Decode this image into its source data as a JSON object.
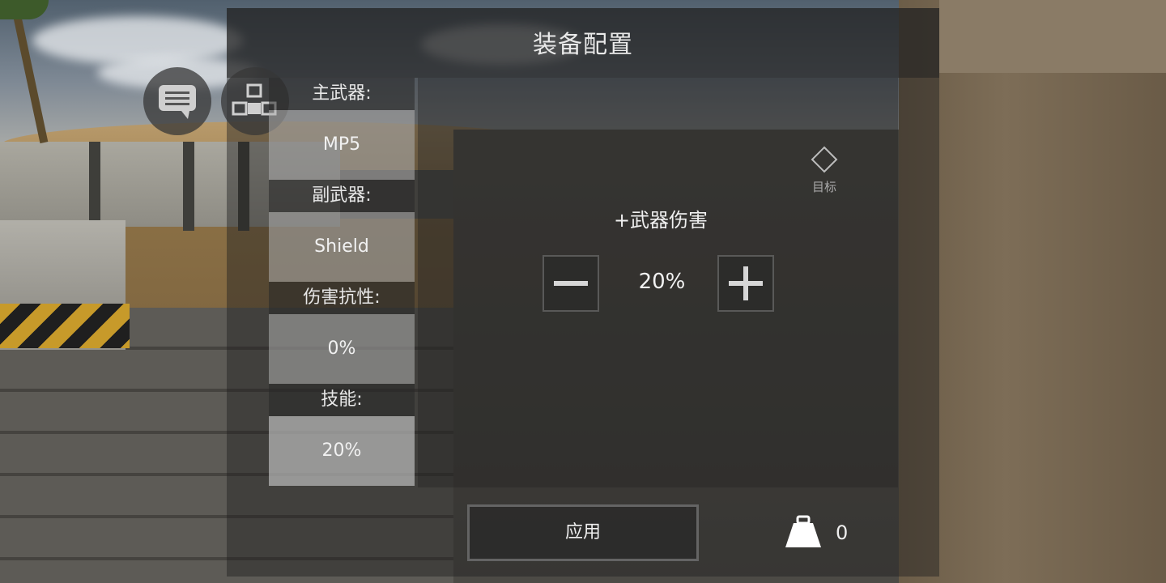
{
  "screen": {
    "title": "装备配置"
  },
  "hud": {
    "chat_icon": "chat-bubble-icon",
    "team_icon": "team-structure-icon"
  },
  "loadout": {
    "slots": [
      {
        "label": "主武器:",
        "value": "MP5"
      },
      {
        "label": "副武器:",
        "value": "Shield"
      },
      {
        "label": "伤害抗性:",
        "value": "0%"
      },
      {
        "label": "技能:",
        "value": "20%"
      }
    ],
    "selected_slot": "技能:"
  },
  "detail": {
    "target_label": "目标",
    "effect_title": "+武器伤害",
    "value": "20%",
    "decrease_icon": "minus-icon",
    "increase_icon": "plus-icon"
  },
  "footer": {
    "apply_label": "应用",
    "weight_icon": "weight-icon",
    "weight_value": "0"
  }
}
